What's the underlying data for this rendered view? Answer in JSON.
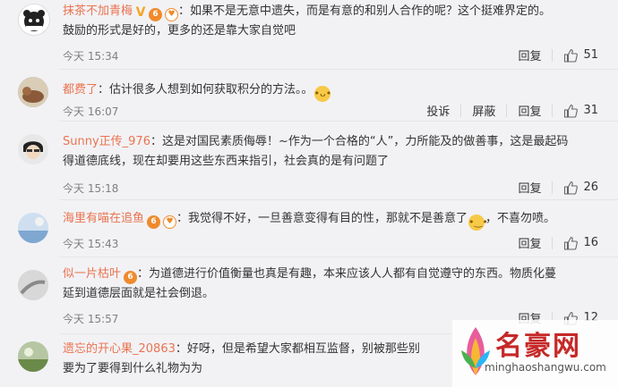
{
  "comments": [
    {
      "username": "抹茶不加青梅",
      "text": "：如果不是无意中遗失，而是有意的和别人合作的呢？这个挺难界定的。",
      "text2": "鼓励的形式是好的，更多的还是靠大家自觉吧",
      "time": "今天 15:34",
      "reply": "回复",
      "likes": "51"
    },
    {
      "username": "都费了",
      "text": "：估计很多人想到如何获取积分的方法。。",
      "time": "今天 16:07",
      "report": "投诉",
      "block": "屏蔽",
      "reply": "回复",
      "likes": "31"
    },
    {
      "username": "Sunny正传_976",
      "text": "：这是对国民素质侮辱！~作为一个合格的“人”，力所能及的做善事，这是最起码",
      "text2": "得道德底线，现在却要用这些东西来指引，社会真的是有问题了",
      "time": "今天 15:18",
      "reply": "回复",
      "likes": "26"
    },
    {
      "username": "海里有喵在追鱼",
      "text": "：我觉得不好，一旦善意变得有目的性，那就不是善意了",
      "text_after": "，不喜勿喷。",
      "time": "今天 15:43",
      "reply": "回复",
      "likes": "16"
    },
    {
      "username": "似一片枯叶",
      "text": "：为道德进行价值衡量也真是有趣，本来应该人人都有自觉遵守的东西。物质化蔓",
      "text2": "延到道德层面就是社会倒退。",
      "time": "今天 15:57",
      "reply": "回复",
      "likes": "12"
    },
    {
      "username": "遗忘的开心果_20863",
      "text": "：好呀，但是希望大家都相互监督，别被那些别",
      "text2": "要为了要得到什么礼物为为"
    }
  ],
  "watermark": {
    "brand": "名豪网",
    "url": "minghaoshangwu.com"
  },
  "colors": {
    "username": "#eb7350",
    "background": "#f2f2f5",
    "meta": "#808080"
  },
  "icons": [
    "thumbs-up-icon",
    "verified-v-icon",
    "vip-badge-icon",
    "emoji-icon"
  ]
}
